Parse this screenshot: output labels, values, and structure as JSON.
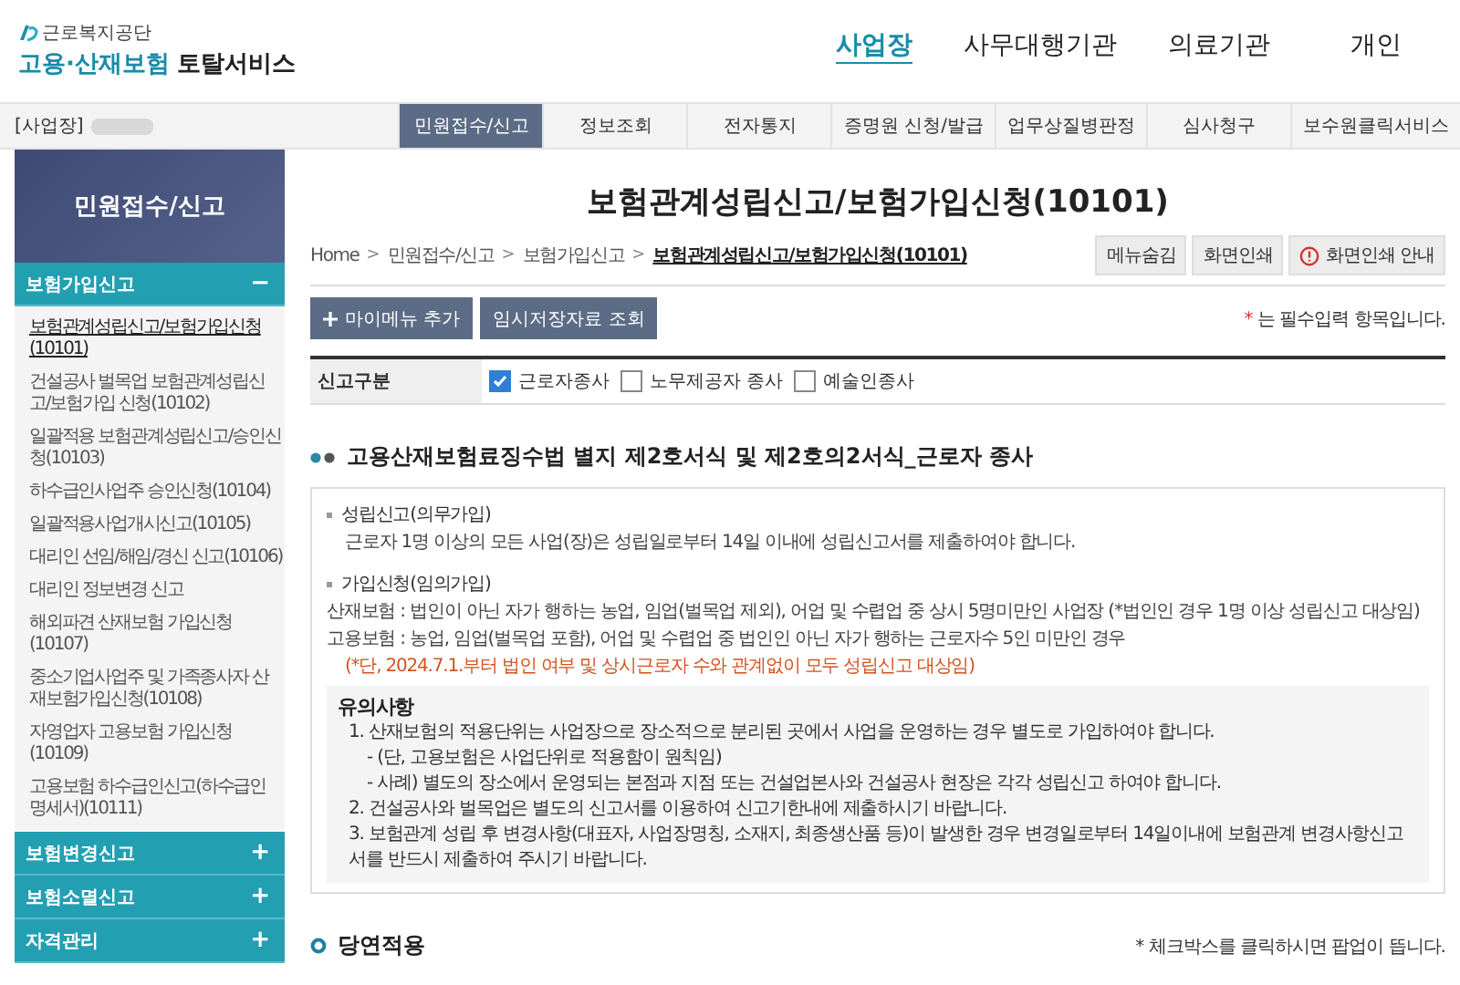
{
  "header": {
    "org": "근로복지공단",
    "service_highlight": "고용·산재보험",
    "service_rest": "토탈서비스",
    "nav": [
      {
        "label": "사업장",
        "selected": true
      },
      {
        "label": "사무대행기관",
        "selected": false
      },
      {
        "label": "의료기관",
        "selected": false
      },
      {
        "label": "개인",
        "selected": false
      }
    ]
  },
  "top_bar": {
    "workplace_label": "[사업장]",
    "menus": [
      {
        "label": "민원접수/신고",
        "selected": true
      },
      {
        "label": "정보조회",
        "selected": false
      },
      {
        "label": "전자통지",
        "selected": false
      },
      {
        "label": "증명원 신청/발급",
        "selected": false
      },
      {
        "label": "업무상질병판정",
        "selected": false
      },
      {
        "label": "심사청구",
        "selected": false
      },
      {
        "label": "보수원클릭서비스",
        "selected": false
      }
    ]
  },
  "sidebar": {
    "title": "민원접수/신고",
    "groups": [
      {
        "label": "보험가입신고",
        "toggle": "−",
        "items": [
          {
            "label": "보험관계성립신고/보험가입신청(10101)",
            "selected": true
          },
          {
            "label": "건설공사 벌목업 보험관계성립신고/보험가입 신청(10102)",
            "selected": false
          },
          {
            "label": "일괄적용 보험관계성립신고/승인신청(10103)",
            "selected": false
          },
          {
            "label": "하수급인사업주 승인신청(10104)",
            "selected": false
          },
          {
            "label": "일괄적용사업개시신고(10105)",
            "selected": false
          },
          {
            "label": "대리인 선임/해임/경신 신고(10106)",
            "selected": false
          },
          {
            "label": "대리인 정보변경 신고",
            "selected": false
          },
          {
            "label": "해외파견 산재보험 가입신청(10107)",
            "selected": false
          },
          {
            "label": "중소기업사업주 및 가족종사자 산재보험가입신청(10108)",
            "selected": false
          },
          {
            "label": "자영업자 고용보험 가입신청(10109)",
            "selected": false
          },
          {
            "label": "고용보험 하수급인신고(하수급인 명세서)(10111)",
            "selected": false
          }
        ]
      },
      {
        "label": "보험변경신고",
        "toggle": "+"
      },
      {
        "label": "보험소멸신고",
        "toggle": "+"
      },
      {
        "label": "자격관리",
        "toggle": "+"
      }
    ]
  },
  "page": {
    "title": "보험관계성립신고/보험가입신청(10101)",
    "breadcrumbs": [
      "Home",
      "민원접수/신고",
      "보험가입신고",
      "보험관계성립신고/보험가입신청(10101)"
    ],
    "breadcrumb_sep": ">",
    "tool_buttons": [
      {
        "label": "메뉴숨김",
        "kind": "plain"
      },
      {
        "label": "화면인쇄",
        "kind": "plain"
      },
      {
        "label": "화면인쇄 안내",
        "kind": "info"
      }
    ],
    "action_buttons": [
      {
        "label": "마이메뉴 추가",
        "kind": "add"
      },
      {
        "label": "임시저장자료 조회",
        "kind": "plain"
      }
    ],
    "required_mark": "*",
    "required_note": "는 필수입력 항목입니다.",
    "form": {
      "label": "신고구분",
      "options": [
        {
          "label": "근로자종사",
          "checked": true
        },
        {
          "label": "노무제공자 종사",
          "checked": false
        },
        {
          "label": "예술인종사",
          "checked": false
        }
      ]
    },
    "section_title": "고용산재보험료징수법 별지 제2호서식 및 제2호의2서식_근로자 종사",
    "info": [
      {
        "kind": "heading",
        "text": "성립신고(의무가입)"
      },
      {
        "kind": "text",
        "text": "근로자 1명 이상의 모든 사업(장)은 성립일로부터 14일 이내에 성립신고서를 제출하여야 합니다."
      },
      {
        "kind": "heading",
        "text": "가입신청(임의가입)"
      },
      {
        "kind": "dash",
        "text": "산재보험 : 법인이 아닌 자가 행하는 농업, 임업(벌목업 제외), 어업 및 수렵업 중 상시 5명미만인 사업장 (*법인인 경우 1명 이상 성립신고 대상임)"
      },
      {
        "kind": "dash",
        "text": "고용보험 : 농업, 임업(벌목업 포함), 어업 및 수렵업 중 법인인 아닌 자가 행하는 근로자수 5인 미만인 경우"
      },
      {
        "kind": "warning",
        "text": "(*단, 2024.7.1.부터 법인 여부 및 상시근로자 수와 관계없이 모두 성립신고 대상임)"
      }
    ],
    "notice": {
      "title": "유의사항",
      "lines": [
        {
          "kind": "numbered",
          "text": "1. 산재보험의 적용단위는 사업장으로 장소적으로 분리된 곳에서 사업을 운영하는 경우 별도로 가입하여야 합니다."
        },
        {
          "kind": "sub",
          "text": "- (단, 고용보험은 사업단위로 적용함이 원칙임)"
        },
        {
          "kind": "sub",
          "text": "- 사례) 별도의 장소에서 운영되는 본점과 지점 또는 건설업본사와 건설공사 현장은 각각 성립신고 하여야 합니다."
        },
        {
          "kind": "numbered",
          "text": "2. 건설공사와 벌목업은 별도의 신고서를 이용하여 신고기한내에 제출하시기 바랍니다."
        },
        {
          "kind": "numbered",
          "text": "3. 보험관계 성립 후 변경사항(대표자, 사업장명칭, 소재지, 최종생산품 등)이 발생한 경우 변경일로부터 14일이내에 보험관계 변경사항신고서를 반드시 제출하여 주시기 바랍니다."
        }
      ]
    },
    "next_section_title": "당연적용",
    "next_section_note": "* 체크박스를 클릭하시면 팝업이 뜹니다."
  }
}
